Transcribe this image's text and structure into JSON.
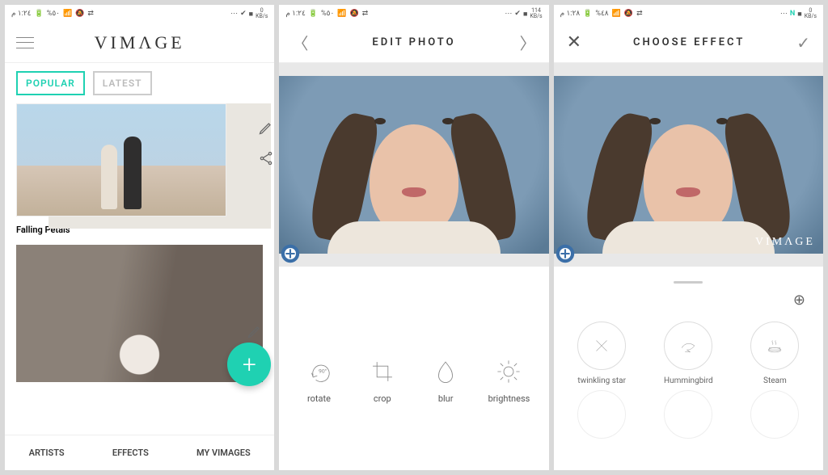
{
  "screen1": {
    "statusbar": {
      "time": "١:٢٤ م",
      "battery": "%٥٠",
      "net": "0",
      "net_unit": "KB/s"
    },
    "app_logo": "VIMΛGE",
    "tabs": {
      "popular": "POPULAR",
      "latest": "LATEST"
    },
    "card1_caption": "Falling Petals",
    "bottom": {
      "artists": "ARTISTS",
      "effects": "EFFECTS",
      "my": "MY VIMAGES"
    }
  },
  "screen2": {
    "statusbar": {
      "time": "١:٢٤ م",
      "battery": "%٥٠",
      "net": "114",
      "net_unit": "KB/s"
    },
    "title": "EDIT PHOTO",
    "tools": {
      "rotate": "rotate",
      "crop": "crop",
      "blur": "blur",
      "brightness": "brightness"
    }
  },
  "screen3": {
    "statusbar": {
      "time": "١:٢٨ م",
      "battery": "%٤٨",
      "net": "0",
      "net_unit": "KB/s"
    },
    "title": "CHOOSE EFFECT",
    "watermark": "VIMΛGE",
    "effects": {
      "e1": "twinkling star",
      "e2": "Hummingbird",
      "e3": "Steam"
    }
  }
}
